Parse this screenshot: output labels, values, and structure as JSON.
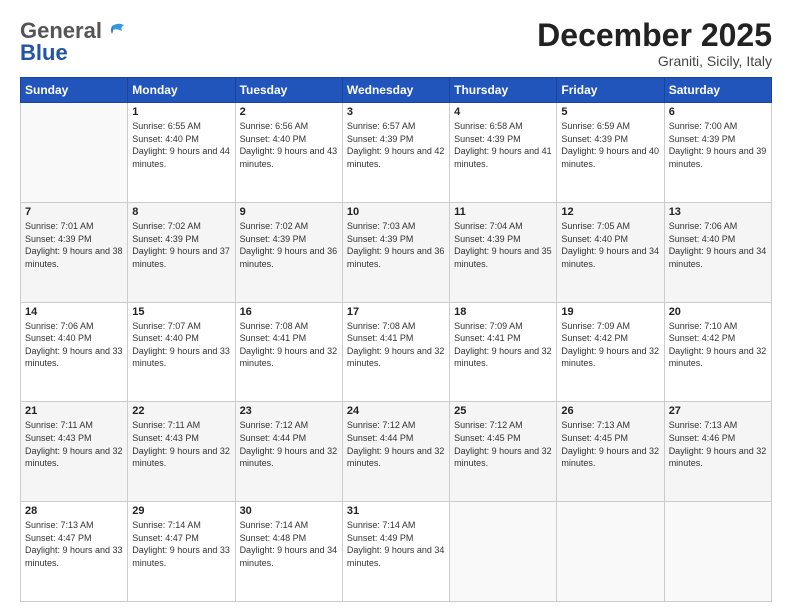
{
  "logo": {
    "part1": "General",
    "part2": "Blue"
  },
  "header": {
    "month": "December 2025",
    "location": "Graniti, Sicily, Italy"
  },
  "weekdays": [
    "Sunday",
    "Monday",
    "Tuesday",
    "Wednesday",
    "Thursday",
    "Friday",
    "Saturday"
  ],
  "weeks": [
    [
      {
        "day": "",
        "sunrise": "",
        "sunset": "",
        "daylight": ""
      },
      {
        "day": "1",
        "sunrise": "Sunrise: 6:55 AM",
        "sunset": "Sunset: 4:40 PM",
        "daylight": "Daylight: 9 hours and 44 minutes."
      },
      {
        "day": "2",
        "sunrise": "Sunrise: 6:56 AM",
        "sunset": "Sunset: 4:40 PM",
        "daylight": "Daylight: 9 hours and 43 minutes."
      },
      {
        "day": "3",
        "sunrise": "Sunrise: 6:57 AM",
        "sunset": "Sunset: 4:39 PM",
        "daylight": "Daylight: 9 hours and 42 minutes."
      },
      {
        "day": "4",
        "sunrise": "Sunrise: 6:58 AM",
        "sunset": "Sunset: 4:39 PM",
        "daylight": "Daylight: 9 hours and 41 minutes."
      },
      {
        "day": "5",
        "sunrise": "Sunrise: 6:59 AM",
        "sunset": "Sunset: 4:39 PM",
        "daylight": "Daylight: 9 hours and 40 minutes."
      },
      {
        "day": "6",
        "sunrise": "Sunrise: 7:00 AM",
        "sunset": "Sunset: 4:39 PM",
        "daylight": "Daylight: 9 hours and 39 minutes."
      }
    ],
    [
      {
        "day": "7",
        "sunrise": "Sunrise: 7:01 AM",
        "sunset": "Sunset: 4:39 PM",
        "daylight": "Daylight: 9 hours and 38 minutes."
      },
      {
        "day": "8",
        "sunrise": "Sunrise: 7:02 AM",
        "sunset": "Sunset: 4:39 PM",
        "daylight": "Daylight: 9 hours and 37 minutes."
      },
      {
        "day": "9",
        "sunrise": "Sunrise: 7:02 AM",
        "sunset": "Sunset: 4:39 PM",
        "daylight": "Daylight: 9 hours and 36 minutes."
      },
      {
        "day": "10",
        "sunrise": "Sunrise: 7:03 AM",
        "sunset": "Sunset: 4:39 PM",
        "daylight": "Daylight: 9 hours and 36 minutes."
      },
      {
        "day": "11",
        "sunrise": "Sunrise: 7:04 AM",
        "sunset": "Sunset: 4:39 PM",
        "daylight": "Daylight: 9 hours and 35 minutes."
      },
      {
        "day": "12",
        "sunrise": "Sunrise: 7:05 AM",
        "sunset": "Sunset: 4:40 PM",
        "daylight": "Daylight: 9 hours and 34 minutes."
      },
      {
        "day": "13",
        "sunrise": "Sunrise: 7:06 AM",
        "sunset": "Sunset: 4:40 PM",
        "daylight": "Daylight: 9 hours and 34 minutes."
      }
    ],
    [
      {
        "day": "14",
        "sunrise": "Sunrise: 7:06 AM",
        "sunset": "Sunset: 4:40 PM",
        "daylight": "Daylight: 9 hours and 33 minutes."
      },
      {
        "day": "15",
        "sunrise": "Sunrise: 7:07 AM",
        "sunset": "Sunset: 4:40 PM",
        "daylight": "Daylight: 9 hours and 33 minutes."
      },
      {
        "day": "16",
        "sunrise": "Sunrise: 7:08 AM",
        "sunset": "Sunset: 4:41 PM",
        "daylight": "Daylight: 9 hours and 32 minutes."
      },
      {
        "day": "17",
        "sunrise": "Sunrise: 7:08 AM",
        "sunset": "Sunset: 4:41 PM",
        "daylight": "Daylight: 9 hours and 32 minutes."
      },
      {
        "day": "18",
        "sunrise": "Sunrise: 7:09 AM",
        "sunset": "Sunset: 4:41 PM",
        "daylight": "Daylight: 9 hours and 32 minutes."
      },
      {
        "day": "19",
        "sunrise": "Sunrise: 7:09 AM",
        "sunset": "Sunset: 4:42 PM",
        "daylight": "Daylight: 9 hours and 32 minutes."
      },
      {
        "day": "20",
        "sunrise": "Sunrise: 7:10 AM",
        "sunset": "Sunset: 4:42 PM",
        "daylight": "Daylight: 9 hours and 32 minutes."
      }
    ],
    [
      {
        "day": "21",
        "sunrise": "Sunrise: 7:11 AM",
        "sunset": "Sunset: 4:43 PM",
        "daylight": "Daylight: 9 hours and 32 minutes."
      },
      {
        "day": "22",
        "sunrise": "Sunrise: 7:11 AM",
        "sunset": "Sunset: 4:43 PM",
        "daylight": "Daylight: 9 hours and 32 minutes."
      },
      {
        "day": "23",
        "sunrise": "Sunrise: 7:12 AM",
        "sunset": "Sunset: 4:44 PM",
        "daylight": "Daylight: 9 hours and 32 minutes."
      },
      {
        "day": "24",
        "sunrise": "Sunrise: 7:12 AM",
        "sunset": "Sunset: 4:44 PM",
        "daylight": "Daylight: 9 hours and 32 minutes."
      },
      {
        "day": "25",
        "sunrise": "Sunrise: 7:12 AM",
        "sunset": "Sunset: 4:45 PM",
        "daylight": "Daylight: 9 hours and 32 minutes."
      },
      {
        "day": "26",
        "sunrise": "Sunrise: 7:13 AM",
        "sunset": "Sunset: 4:45 PM",
        "daylight": "Daylight: 9 hours and 32 minutes."
      },
      {
        "day": "27",
        "sunrise": "Sunrise: 7:13 AM",
        "sunset": "Sunset: 4:46 PM",
        "daylight": "Daylight: 9 hours and 32 minutes."
      }
    ],
    [
      {
        "day": "28",
        "sunrise": "Sunrise: 7:13 AM",
        "sunset": "Sunset: 4:47 PM",
        "daylight": "Daylight: 9 hours and 33 minutes."
      },
      {
        "day": "29",
        "sunrise": "Sunrise: 7:14 AM",
        "sunset": "Sunset: 4:47 PM",
        "daylight": "Daylight: 9 hours and 33 minutes."
      },
      {
        "day": "30",
        "sunrise": "Sunrise: 7:14 AM",
        "sunset": "Sunset: 4:48 PM",
        "daylight": "Daylight: 9 hours and 34 minutes."
      },
      {
        "day": "31",
        "sunrise": "Sunrise: 7:14 AM",
        "sunset": "Sunset: 4:49 PM",
        "daylight": "Daylight: 9 hours and 34 minutes."
      },
      {
        "day": "",
        "sunrise": "",
        "sunset": "",
        "daylight": ""
      },
      {
        "day": "",
        "sunrise": "",
        "sunset": "",
        "daylight": ""
      },
      {
        "day": "",
        "sunrise": "",
        "sunset": "",
        "daylight": ""
      }
    ]
  ]
}
